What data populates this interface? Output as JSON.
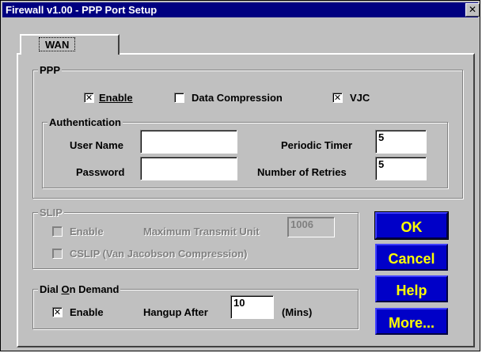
{
  "window": {
    "title": "Firewall v1.00 - PPP Port Setup",
    "close_glyph": "✕"
  },
  "tabs": [
    {
      "label": "WAN"
    }
  ],
  "ppp": {
    "legend": "PPP",
    "enable": {
      "label": "Enable",
      "checked": true
    },
    "data_compression": {
      "label": "Data Compression",
      "checked": false
    },
    "vjc": {
      "label": "VJC",
      "checked": true
    },
    "authentication": {
      "legend": "Authentication",
      "user_name_label": "User Name",
      "user_name_value": "",
      "password_label": "Password",
      "password_value": "",
      "periodic_timer_label": "Periodic Timer",
      "periodic_timer_value": "5",
      "retries_label": "Number of Retries",
      "retries_value": "5"
    }
  },
  "slip": {
    "legend": "SLIP",
    "enable": {
      "label": "Enable",
      "checked": false
    },
    "mtu_label": "Maximum Transmit Unit",
    "mtu_value": "1006",
    "cslip": {
      "label": "CSLIP (Van Jacobson Compression)",
      "checked": false
    }
  },
  "dod": {
    "legend": "Dial On Demand",
    "enable": {
      "label": "Enable",
      "checked": true
    },
    "hangup_label": "Hangup After",
    "hangup_value": "10",
    "units": "(Mins)"
  },
  "buttons": {
    "ok": "OK",
    "cancel": "Cancel",
    "help": "Help",
    "more": "More..."
  },
  "check_glyph": "✕",
  "colors": {
    "titlebar": "#000080",
    "button_bg": "#0000c8",
    "button_text": "#ffff00"
  }
}
